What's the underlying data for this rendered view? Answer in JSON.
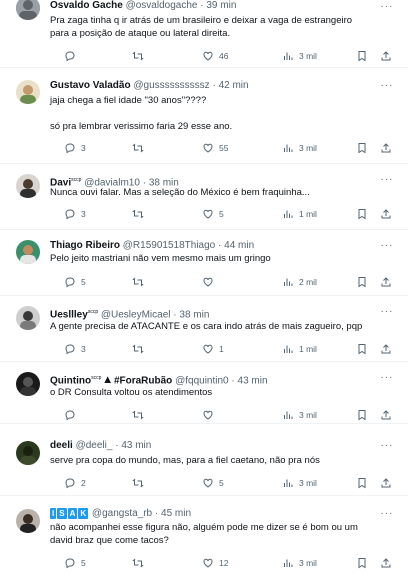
{
  "icons": {
    "reply": "reply-icon",
    "retweet": "retweet-icon",
    "like": "heart-icon",
    "views": "views-icon",
    "bookmark": "bookmark-icon",
    "share": "share-icon",
    "more": "more-icon"
  },
  "colors": {
    "text": "#0f1419",
    "muted": "#536471",
    "divider": "#eff3f4",
    "verified": "#1d9bf0"
  },
  "tweets": [
    {
      "name": "Osvaldo Gache",
      "handle": "@osvaldogache",
      "time": "39 min",
      "text": [
        "Pra zaga tinha q ir atrás de um brasileiro e deixar a vaga de estrangeiro",
        "para a posição de ataque ou lateral direita."
      ],
      "replies": "",
      "retweets": "",
      "likes": "46",
      "views": "3 mil"
    },
    {
      "name": "Gustavo Valadão",
      "handle": "@gussssssssssz",
      "time": "42 min",
      "text": [
        "jaja chega a fiel idade \"30 anos\"????",
        "",
        "só pra lembrar verissimo faria 29 esse ano."
      ],
      "replies": "3",
      "retweets": "",
      "likes": "55",
      "views": "3 mil"
    },
    {
      "name": "Davi",
      "name_suffix": "sccp",
      "handle": "@davialm10",
      "time": "38 min",
      "text": [
        "Nunca ouvi falar. Mas a seleção do México é bem fraquinha..."
      ],
      "replies": "3",
      "retweets": "",
      "likes": "5",
      "views": "1 mil"
    },
    {
      "name": "Thiago Ribeiro",
      "handle": "@R15901518Thiago",
      "time": "44 min",
      "text": [
        "Pelo jeito mastriani não vem mesmo mais um gringo"
      ],
      "replies": "5",
      "retweets": "",
      "likes": "",
      "views": "2 mil"
    },
    {
      "name": "Uesllley",
      "name_suffix": "sccp",
      "handle": "@UesleyMicael",
      "time": "38 min",
      "text": [
        "A gente precisa de ATACANTE e os cara indo atrás de mais zagueiro, pqp"
      ],
      "replies": "3",
      "retweets": "",
      "likes": "1",
      "views": "1 mil"
    },
    {
      "name": "Quintino",
      "name_suffix": "sccp",
      "name_extra": "#ForaRubão",
      "handle": "@fqquintin0",
      "time": "43 min",
      "text": [
        "o DR Consulta voltou os atendimentos"
      ],
      "replies": "",
      "retweets": "",
      "likes": "",
      "views": "3 mil"
    },
    {
      "name": "deeli",
      "handle": "@deeli_",
      "time": "43 min",
      "text": [
        "serve pra copa do mundo, mas, para a fiel caetano, não pra nós"
      ],
      "replies": "2",
      "retweets": "",
      "likes": "5",
      "views": "3 mil"
    },
    {
      "name": "I S A K",
      "name_letters": [
        "I",
        "S",
        "A",
        "K"
      ],
      "handle": "@gangsta_rb",
      "time": "45 min",
      "text": [
        "não acompanhei esse figura não, alguém pode me dizer se é bom ou um",
        "david braz que come tacos?"
      ],
      "replies": "5",
      "retweets": "",
      "likes": "12",
      "views": "3 mil"
    }
  ]
}
